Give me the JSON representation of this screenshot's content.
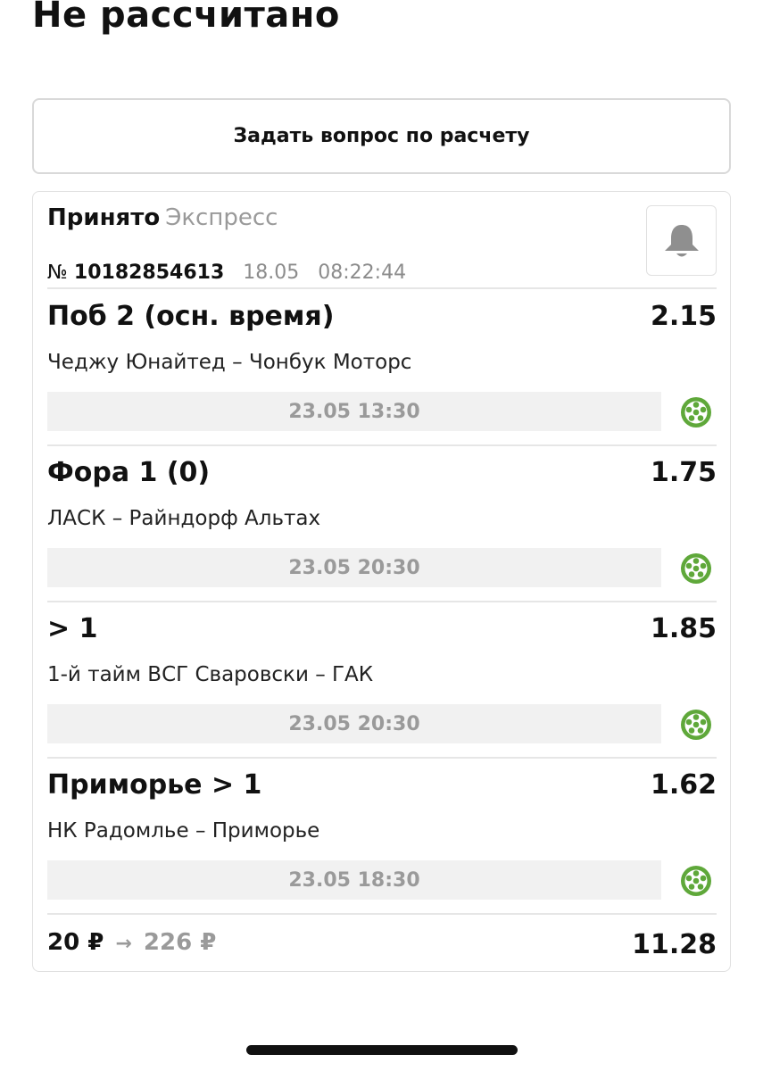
{
  "header": {
    "title": "Не рассчитано"
  },
  "ask_button": {
    "label": "Задать вопрос по расчету"
  },
  "ticket": {
    "status": "Принято",
    "type": "Экспресс",
    "number_prefix": "№",
    "number": "10182854613",
    "date": "18.05",
    "time": "08:22:44",
    "bell_icon": "bell-icon"
  },
  "events": [
    {
      "outcome": "Поб 2 (осн. время)",
      "odds": "2.15",
      "match": "Чеджу Юнайтед – Чонбук Моторс",
      "start": "23.05 13:30",
      "sport_icon": "football-icon"
    },
    {
      "outcome": "Фора 1 (0)",
      "odds": "1.75",
      "match": "ЛАСК – Райндорф Альтах",
      "start": "23.05 20:30",
      "sport_icon": "football-icon"
    },
    {
      "outcome": "> 1",
      "odds": "1.85",
      "match": "1-й тайм ВСГ Сваровски – ГАК",
      "start": "23.05 20:30",
      "sport_icon": "football-icon"
    },
    {
      "outcome": "Приморье > 1",
      "odds": "1.62",
      "match": "НК Радомлье – Приморье",
      "start": "23.05 18:30",
      "sport_icon": "football-icon"
    }
  ],
  "summary": {
    "stake": "20 ₽",
    "arrow": "→",
    "potential_win": "226 ₽",
    "total_odds": "11.28"
  },
  "colors": {
    "accent_green": "#5fa83a",
    "muted_gray": "#9a9a9a",
    "bar_bg": "#f1f1f1"
  }
}
